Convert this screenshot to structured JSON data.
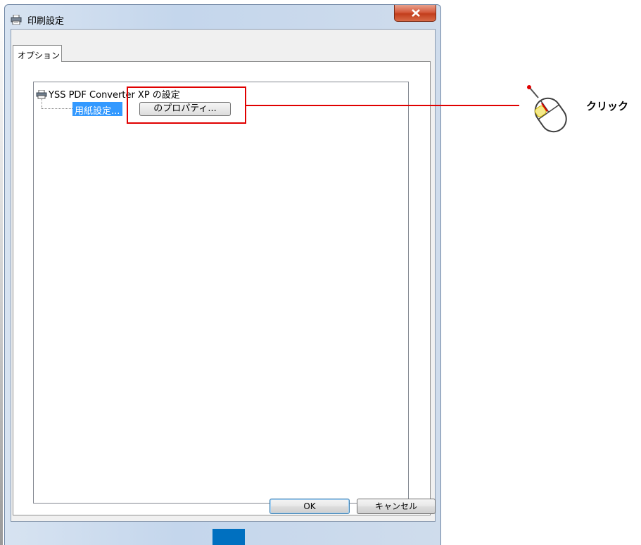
{
  "window": {
    "title": "印刷設定",
    "close_symbol": "x"
  },
  "tabs": [
    {
      "label": "オプション",
      "selected": true
    }
  ],
  "tree": {
    "root_label": "YSS PDF Converter XP の設定",
    "child_label": "用紙設定...",
    "properties_button": "のプロパティ..."
  },
  "buttons": {
    "ok": "OK",
    "cancel": "キャンセル"
  },
  "annotation": {
    "click_label": "クリック",
    "highlight_color": "#e00000"
  },
  "icons": {
    "title": "printer-icon",
    "tree_root": "printer-icon",
    "annotation": "mouse-icon"
  },
  "colors": {
    "selection": "#3399ff",
    "marker": "#0070c0"
  }
}
